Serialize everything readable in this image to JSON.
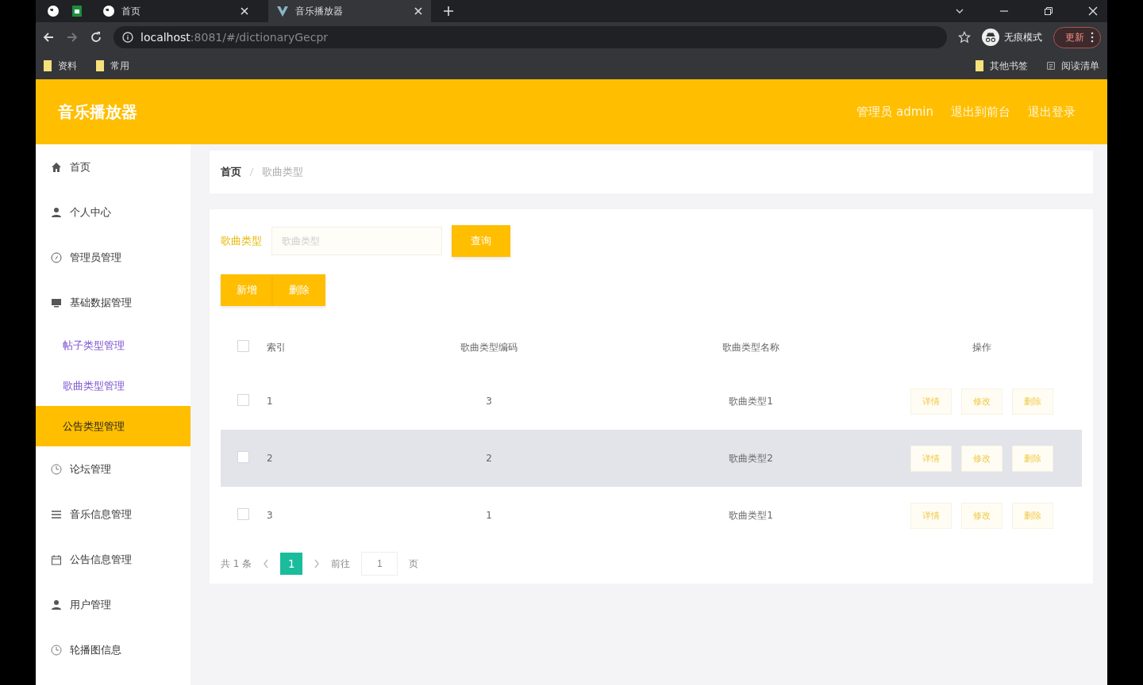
{
  "browser": {
    "tabs": [
      {
        "label": "首页",
        "selected": false
      },
      {
        "label": "音乐播放器",
        "selected": true
      }
    ],
    "url_host": "localhost",
    "url_path": ":8081/#/dictionaryGecpr",
    "incognito_label": "无痕模式",
    "update_label": "更新",
    "bookmarks": [
      "资料",
      "常用"
    ],
    "bookmarks_right": [
      "其他书签",
      "阅读清单"
    ]
  },
  "header": {
    "title": "音乐播放器",
    "links": [
      "管理员 admin",
      "退出到前台",
      "退出登录"
    ]
  },
  "sidebar": {
    "items": [
      {
        "label": "首页",
        "kind": "home",
        "selected": false
      },
      {
        "label": "个人中心",
        "kind": "user",
        "selected": false
      },
      {
        "label": "管理员管理",
        "kind": "compass",
        "selected": false
      },
      {
        "label": "基础数据管理",
        "kind": "monitor",
        "selected": false,
        "children": [
          {
            "label": "帖子类型管理",
            "selected": false
          },
          {
            "label": "歌曲类型管理",
            "selected": false
          },
          {
            "label": "公告类型管理",
            "selected": true
          }
        ]
      },
      {
        "label": "论坛管理",
        "kind": "clock",
        "selected": false
      },
      {
        "label": "音乐信息管理",
        "kind": "list",
        "selected": false
      },
      {
        "label": "公告信息管理",
        "kind": "calendar",
        "selected": false
      },
      {
        "label": "用户管理",
        "kind": "user",
        "selected": false
      },
      {
        "label": "轮播图信息",
        "kind": "clock",
        "selected": false
      }
    ]
  },
  "breadcrumb": [
    "首页",
    "歌曲类型"
  ],
  "search": {
    "label": "歌曲类型",
    "placeholder": "歌曲类型",
    "button": "查询"
  },
  "actions": [
    "新增",
    "删除"
  ],
  "table": {
    "columns": [
      "索引",
      "歌曲类型编码",
      "歌曲类型名称",
      "操作"
    ],
    "all_checked": false,
    "rows": [
      {
        "cells": [
          "1",
          "3",
          "歌曲类型1"
        ],
        "hovered": false,
        "checked": false,
        "actions": [
          "详情",
          "修改",
          "删除"
        ]
      },
      {
        "cells": [
          "2",
          "2",
          "歌曲类型2"
        ],
        "hovered": true,
        "checked": false,
        "actions": [
          "详情",
          "修改",
          "删除"
        ]
      },
      {
        "cells": [
          "3",
          "1",
          "歌曲类型1"
        ],
        "hovered": false,
        "checked": false,
        "actions": [
          "详情",
          "修改",
          "删除"
        ]
      }
    ]
  },
  "pagination": {
    "total": "共 1 条",
    "pages": [
      {
        "label": "1",
        "selected": true
      }
    ],
    "goto_label": "前往",
    "goto_value": "1",
    "page_suffix": "页"
  }
}
